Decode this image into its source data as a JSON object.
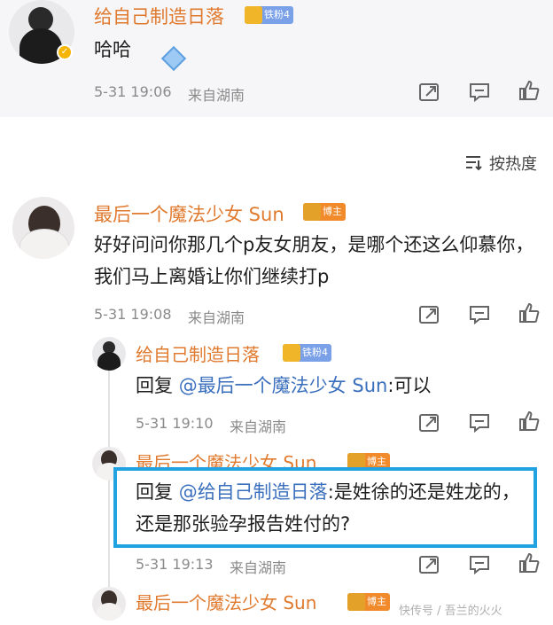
{
  "comments": [
    {
      "author": "给自己制造日落",
      "badge": "铁粉4",
      "text": "哈哈",
      "time": "5-31 19:06",
      "location": "来自湖南"
    },
    {
      "author": "最后一个魔法少女 Sun",
      "badge": "博主",
      "text": "好好问问你那几个p友女朋友，是哪个还这么仰慕你，我们马上离婚让你们继续打p",
      "time": "5-31 19:08",
      "location": "来自湖南",
      "replies": [
        {
          "author": "给自己制造日落",
          "badge": "铁粉4",
          "reply_prefix": "回复",
          "mention": "@最后一个魔法少女 Sun",
          "text": ":可以",
          "time": "5-31 19:10",
          "location": "来自湖南"
        },
        {
          "author": "最后一个魔法少女 Sun",
          "badge": "博主",
          "reply_prefix": "回复",
          "mention": "@给自己制造日落",
          "text": ":是姓徐的还是姓龙的，还是那张验孕报告姓付的?",
          "time": "5-31 19:13",
          "location": "来自湖南"
        },
        {
          "author": "最后一个魔法少女 Sun",
          "badge": "博主"
        }
      ]
    }
  ],
  "sort_label": "按热度",
  "watermark": "快传号 / 吾兰的火火",
  "icons": {
    "share": "share-icon",
    "comment": "comment-icon",
    "like": "like-icon",
    "sort": "sort-icon"
  },
  "colors": {
    "name": "#e07a2f",
    "mention": "#3a6fbd",
    "highlight_border": "#20a3e0"
  }
}
